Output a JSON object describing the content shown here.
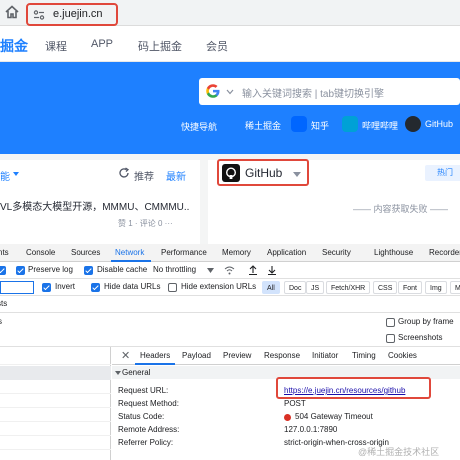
{
  "browser": {
    "url": "e.juejin.cn"
  },
  "site": {
    "logo_text": "掘金",
    "nav": [
      "课程",
      "APP",
      "码上掘金",
      "会员"
    ]
  },
  "banner": {
    "search_placeholder": "输入关键词搜索 | tab键切换引擎",
    "quick_label": "快捷导航",
    "quick_links": [
      {
        "label": "稀土掘金",
        "color": "#1e80ff"
      },
      {
        "label": "知乎",
        "color": "#0066ff"
      },
      {
        "label": "哔哩哔哩",
        "color": "#00a1d6"
      },
      {
        "label": "GitHub",
        "color": "#24292f"
      }
    ]
  },
  "left_card": {
    "category": "能",
    "refresh_tab": "推荐",
    "new_tab": "最新",
    "article_title": "VL多模态大模型开源，MMMU、CMMMU...",
    "article_meta": "赞 1 · 评论 0 ···"
  },
  "right_card": {
    "source_name": "GitHub",
    "hot_button": "热门",
    "empty_message": "—— 内容获取失败 ——"
  },
  "devtools": {
    "tabs": [
      "nts",
      "Console",
      "Sources",
      "Network",
      "Performance",
      "Memory",
      "Application",
      "Security",
      "Lighthouse",
      "Recorder"
    ],
    "active_tab": "Network",
    "toolbar": {
      "preserve_log": "Preserve log",
      "disable_cache": "Disable cache",
      "throttling": "No throttling"
    },
    "filter_bar": {
      "invert": "Invert",
      "hide_data_urls": "Hide data URLs",
      "hide_extension_urls": "Hide extension URLs",
      "chips": [
        "All",
        "Doc",
        "JS",
        "Fetch/XHR",
        "CSS",
        "Font",
        "Img",
        "Medi"
      ]
    },
    "row3_text": "sts",
    "row4": {
      "left_text": "s",
      "group_by_frame": "Group by frame",
      "screenshots": "Screenshots"
    },
    "detail_tabs": [
      "Headers",
      "Payload",
      "Preview",
      "Response",
      "Initiator",
      "Timing",
      "Cookies"
    ],
    "active_detail_tab": "Headers",
    "general_label": "General",
    "general": [
      {
        "key": "Request URL:",
        "value": "https://e.juejin.cn/resources/github"
      },
      {
        "key": "Request Method:",
        "value": "POST"
      },
      {
        "key": "Status Code:",
        "value": "504 Gateway Timeout"
      },
      {
        "key": "Remote Address:",
        "value": "127.0.0.1:7890"
      },
      {
        "key": "Referrer Policy:",
        "value": "strict-origin-when-cross-origin"
      }
    ]
  },
  "watermark": "@稀土掘金技术社区"
}
